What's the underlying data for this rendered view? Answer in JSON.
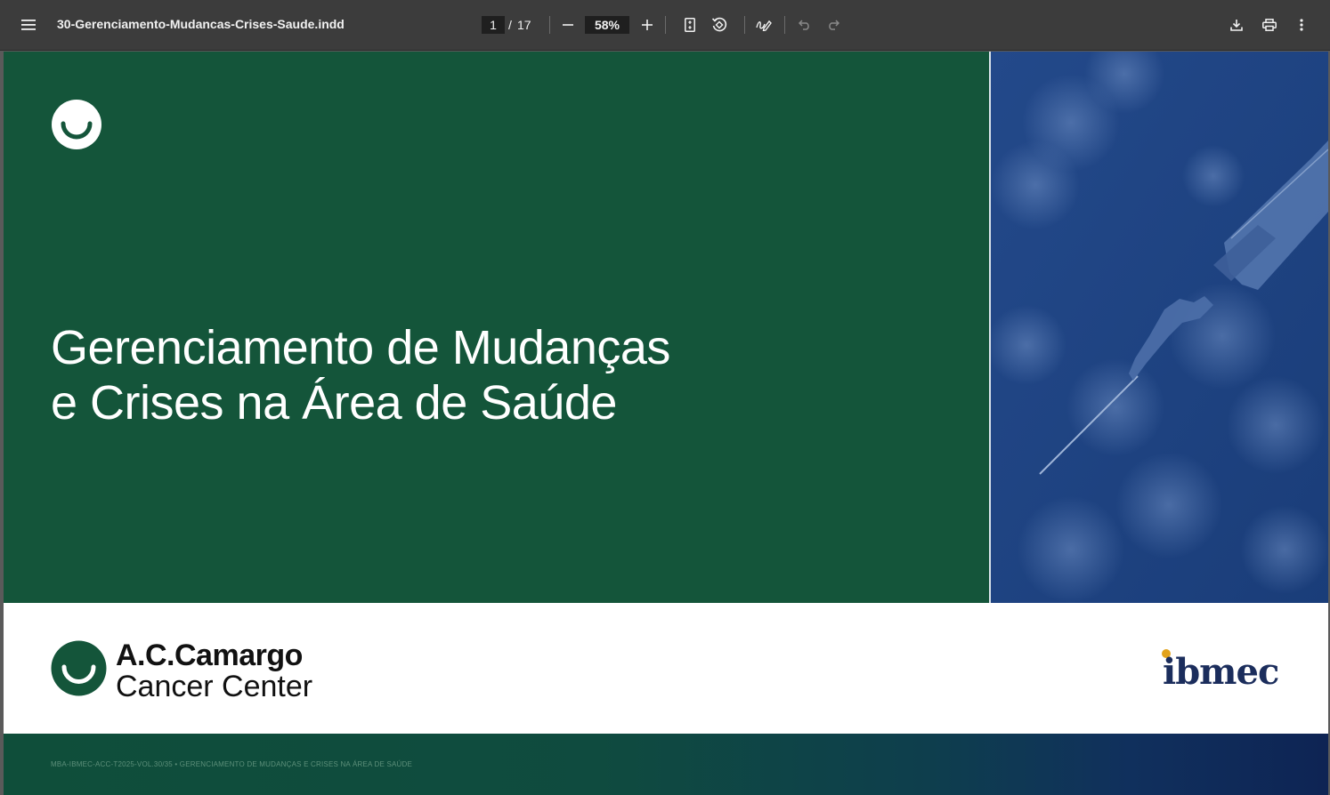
{
  "toolbar": {
    "title": "30-Gerenciamento-Mudancas-Crises-Saude.indd",
    "page_current": "1",
    "page_separator": "/",
    "page_total": "17",
    "zoom": "58%"
  },
  "icons": {
    "menu": "hamburger-menu-icon",
    "zoom_out": "minus-icon",
    "zoom_in": "plus-icon",
    "fit": "fit-page-icon",
    "rotate": "rotate-icon",
    "annotate": "pen-icon",
    "undo": "undo-icon",
    "redo": "redo-icon",
    "download": "download-icon",
    "print": "print-icon",
    "more": "more-vertical-icon"
  },
  "document": {
    "title_line1": "Gerenciamento de Mudanças",
    "title_line2": "e Crises na Área de Saúde",
    "brand_name": "A.C.Camargo",
    "brand_sub": "Cancer Center",
    "partner": "ibmec",
    "footer": "MBA-IBMEC-ACC-T2025-VOL.30/35 • GERENCIAMENTO DE MUDANÇAS E CRISES NA ÁREA DE SAÚDE"
  },
  "colors": {
    "toolbar": "#3c3c3c",
    "cover_green": "#14553a",
    "photo_blue": "#1e4583",
    "ibmec_navy": "#1b2d5c",
    "ibmec_accent": "#e2a21b"
  }
}
